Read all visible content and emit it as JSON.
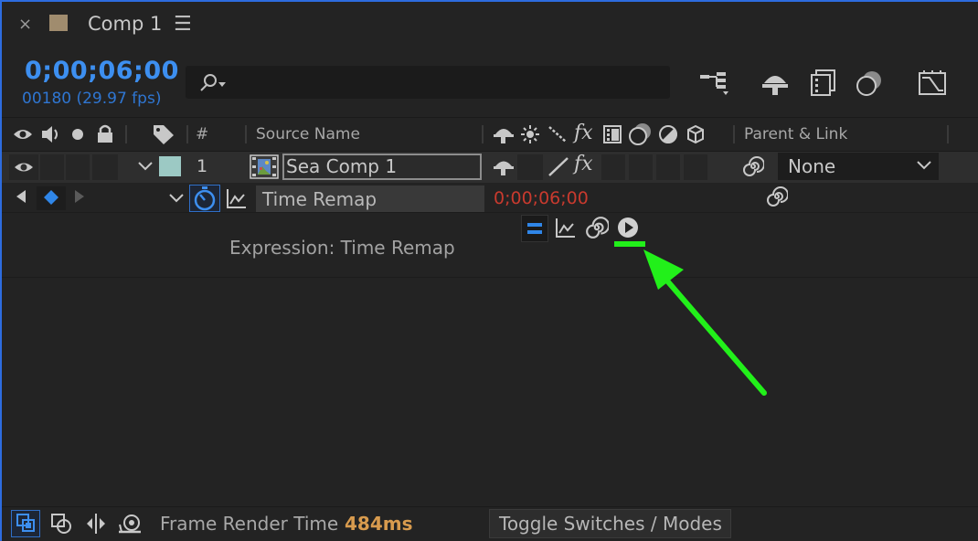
{
  "tab": {
    "title": "Comp 1",
    "close_glyph": "×",
    "menu_glyph": "☰",
    "swatch_color": "#a08c6e"
  },
  "time": {
    "timecode": "0;00;06;00",
    "frames": "00180 (29.97 fps)"
  },
  "search": {
    "placeholder": ""
  },
  "headers": {
    "hash": "#",
    "source_name": "Source Name",
    "parent_link": "Parent & Link"
  },
  "layer": {
    "number": "1",
    "name": "Sea Comp 1",
    "parent": "None",
    "label_color": "#9cc9c4"
  },
  "property": {
    "name": "Time Remap",
    "value": "0;00;06;00"
  },
  "expression": {
    "label": "Expression: Time Remap"
  },
  "footer": {
    "render_label": "Frame Render Time",
    "render_value": "484ms",
    "toggle_label": "Toggle Switches / Modes"
  },
  "colors": {
    "accent": "#3d8ff0",
    "value_red": "#c83a2e",
    "render_orange": "#d89b4e",
    "annotation_green": "#22f01a"
  }
}
